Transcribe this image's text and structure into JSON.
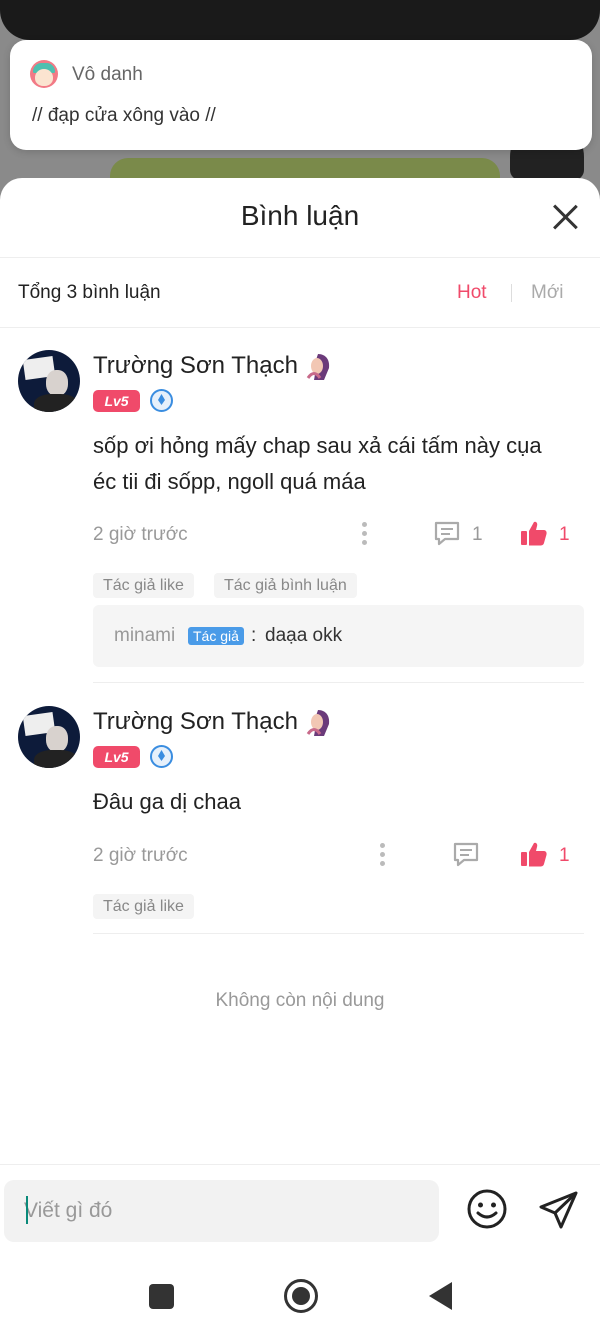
{
  "notification": {
    "sender": "Vô danh",
    "message": "// đạp cửa xông vào //"
  },
  "sheet": {
    "title": "Bình luận",
    "total": "Tổng 3 bình luận",
    "sort_hot": "Hot",
    "sort_new": "Mới"
  },
  "comments": [
    {
      "author": "Trường Sơn Thạch",
      "level": "Lv5",
      "text_line1": "sốp ơi hỏng mấy chap sau xả cái tấm này cụa",
      "text_line2": "éc tii đi sốpp, ngoll quá máa",
      "time": "2 giờ trước",
      "reply_count": "1",
      "like_count": "1",
      "tags": [
        "Tác giả like",
        "Tác giả bình luận"
      ],
      "reply": {
        "user": "minami",
        "badge": "Tác giả",
        "colon": ":",
        "text": "daạa okk"
      }
    },
    {
      "author": "Trường Sơn Thạch",
      "level": "Lv5",
      "text_line1": "Đâu ga dị chaa",
      "time": "2 giờ trước",
      "like_count": "1",
      "tags": [
        "Tác giả like"
      ]
    }
  ],
  "end_text": "Không còn nội dung",
  "composer": {
    "placeholder": "Viết gì đó"
  },
  "icons": {
    "close": "close-icon",
    "more": "more-vertical-icon",
    "reply": "comment-icon",
    "like": "thumbs-up-icon",
    "emoji": "smiley-icon",
    "send": "send-icon"
  },
  "colors": {
    "accent": "#f04a6a",
    "author_badge": "#4a9be8"
  }
}
